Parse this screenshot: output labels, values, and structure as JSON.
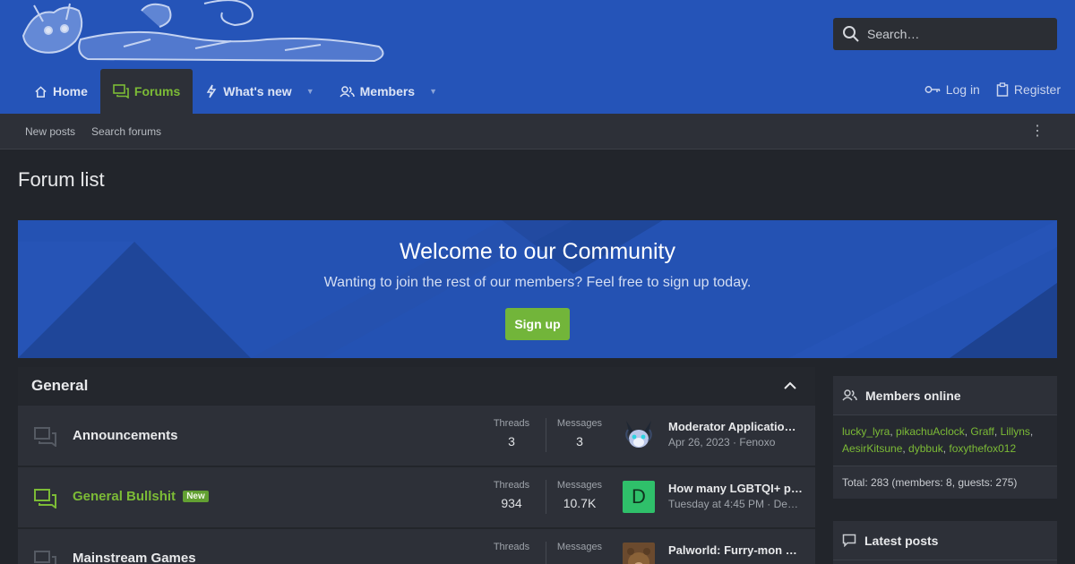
{
  "header": {
    "search_placeholder": "Search…",
    "nav": [
      {
        "label": "Home",
        "icon": "home-icon"
      },
      {
        "label": "Forums",
        "icon": "forums-icon",
        "active": true
      },
      {
        "label": "What's new",
        "icon": "bolt-icon",
        "dropdown": true
      },
      {
        "label": "Members",
        "icon": "members-icon",
        "dropdown": true
      }
    ],
    "login_label": "Log in",
    "register_label": "Register"
  },
  "subnav": {
    "new_posts": "New posts",
    "search_forums": "Search forums"
  },
  "page_title": "Forum list",
  "welcome": {
    "title": "Welcome to our Community",
    "text": "Wanting to join the rest of our members? Feel free to sign up today.",
    "button": "Sign up"
  },
  "category": {
    "title": "General",
    "forums": [
      {
        "title": "Announcements",
        "unread": false,
        "threads_label": "Threads",
        "threads": "3",
        "messages_label": "Messages",
        "messages": "3",
        "last_title": "Moderator Application…",
        "last_meta": "Apr 26, 2023 · Fenoxo"
      },
      {
        "title": "General Bullshit",
        "unread": true,
        "badge": "New",
        "threads_label": "Threads",
        "threads": "934",
        "messages_label": "Messages",
        "messages": "10.7K",
        "avatar_letter": "D",
        "last_title": "How many LGBTQI+ p…",
        "last_meta": "Tuesday at 4:45 PM · De…"
      },
      {
        "title": "Mainstream Games",
        "unread": false,
        "threads_label": "Threads",
        "threads": "",
        "messages_label": "Messages",
        "messages": "",
        "last_title": "Palworld: Furry-mon …",
        "last_meta": ""
      }
    ]
  },
  "sidebar": {
    "members_online": {
      "title": "Members online",
      "members": [
        "lucky_lyra",
        "pikachuAclock",
        "Graff",
        "Lillyns",
        "AesirKitsune",
        "dybbuk",
        "foxythefox012"
      ],
      "total": "Total: 283 (members: 8, guests: 275)"
    },
    "latest_posts": {
      "title": "Latest posts"
    }
  },
  "colors": {
    "header_blue": "#2554b8",
    "accent_green": "#7cbb36",
    "background": "#22252b",
    "panel": "#2d3038"
  }
}
